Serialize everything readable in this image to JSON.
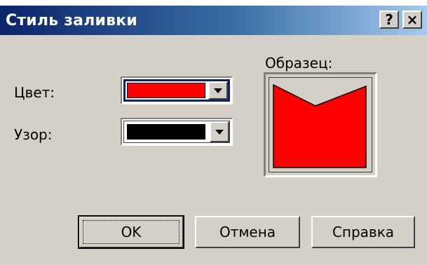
{
  "dialog": {
    "title": "Стиль заливки",
    "help_button": "?",
    "close_button": "×"
  },
  "fields": {
    "color_label": "Цвет:",
    "color_value": "#ff0000",
    "pattern_label": "Узор:",
    "pattern_value": "#000000"
  },
  "preview": {
    "label": "Образец:",
    "fill": "#ff0000"
  },
  "buttons": {
    "ok": "OK",
    "cancel": "Отмена",
    "help": "Справка"
  }
}
